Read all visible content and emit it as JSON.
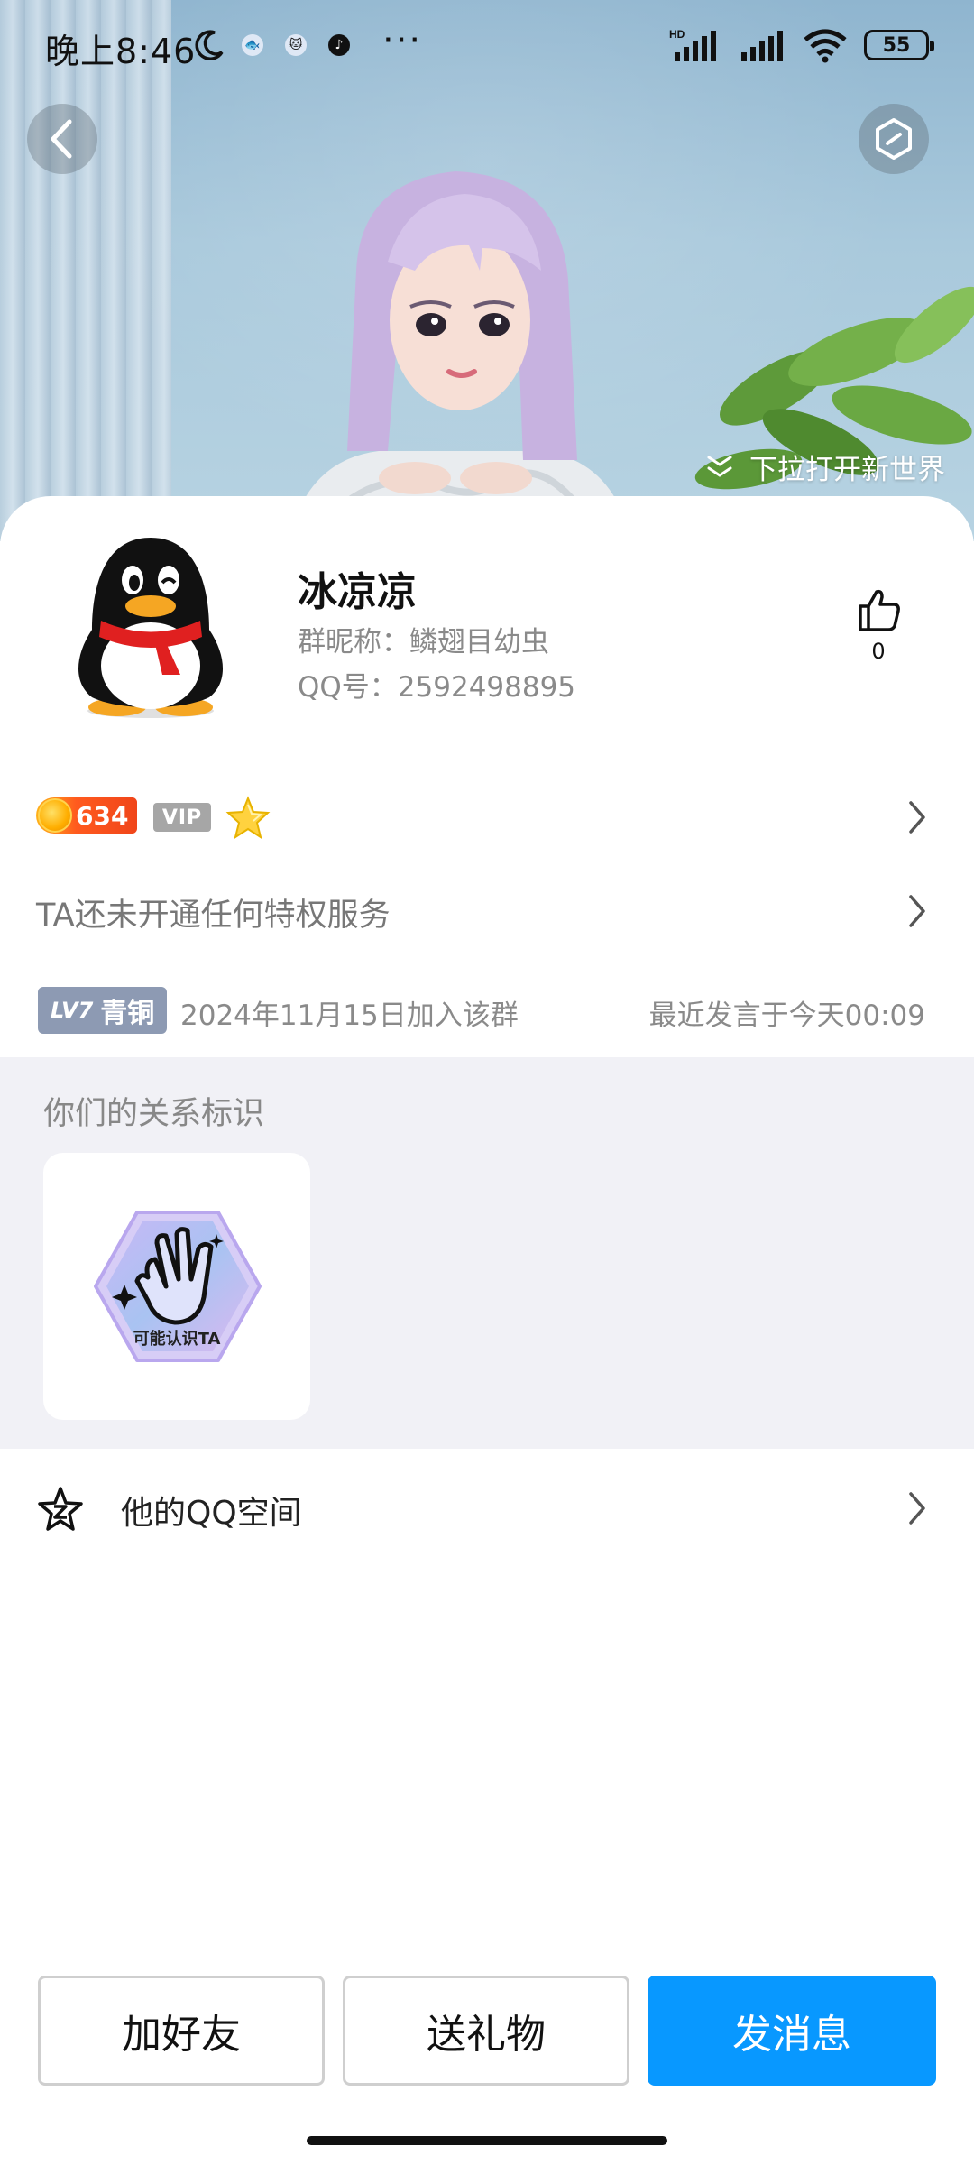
{
  "status_bar": {
    "time": "晚上8:46",
    "battery": "55",
    "network_label": "HD"
  },
  "hero": {
    "pull_hint": "下拉打开新世界"
  },
  "profile": {
    "nickname": "冰凉凉",
    "group_nickname": "群昵称：鳞翅目幼虫",
    "qq_number": "QQ号：2592498895",
    "like_count": "0"
  },
  "badges": {
    "coin_value": "634",
    "vip_label": "VIP"
  },
  "privilege": {
    "text": "TA还未开通任何特权服务"
  },
  "group_info": {
    "level_tag": "LV7",
    "level_name": "青铜",
    "joined": "2024年11月15日加入该群",
    "last_spoke": "最近发言于今天00:09"
  },
  "relationship": {
    "title": "你们的关系标识",
    "tag_label": "可能认识TA"
  },
  "qzone": {
    "label": "他的QQ空间"
  },
  "actions": {
    "add_friend": "加好友",
    "send_gift": "送礼物",
    "send_message": "发消息"
  },
  "colors": {
    "primary_blue": "#0898FF",
    "level_badge": "#8D9AB3",
    "section_bg": "#F1F1F6"
  }
}
